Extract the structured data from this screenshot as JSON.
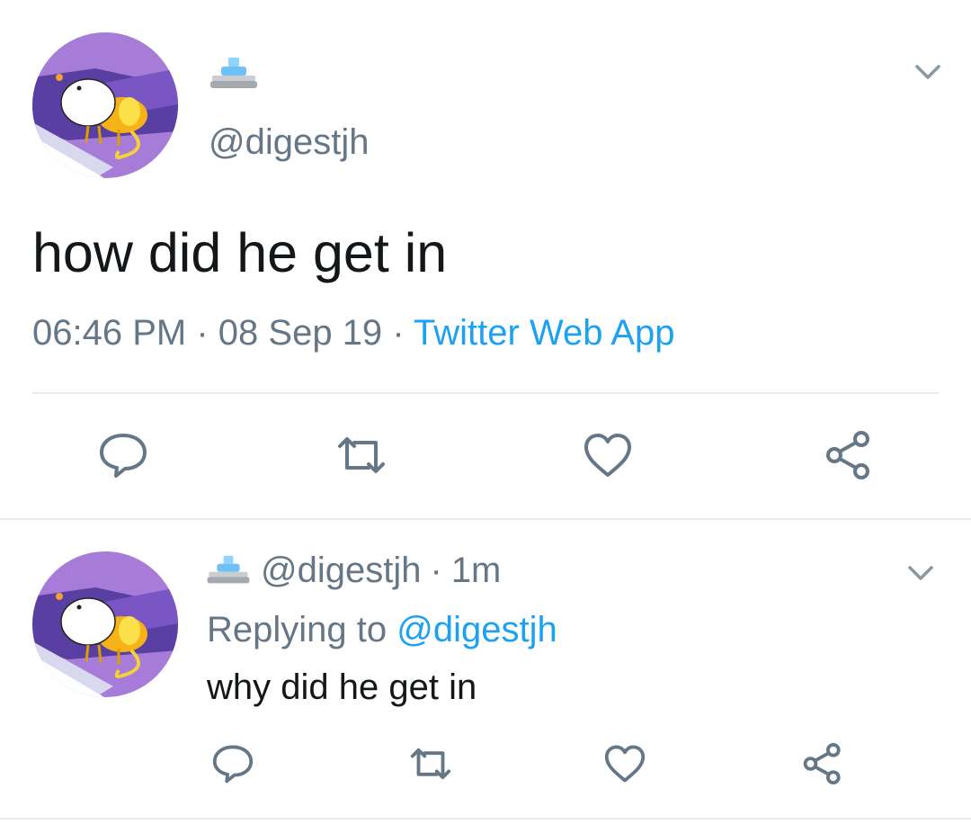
{
  "main_tweet": {
    "handle": "@digestjh",
    "display_name_icon": "fountain-emoji",
    "text": "how did he get in",
    "time": "06:46 PM",
    "separator": "·",
    "date": "08 Sep 19",
    "source": "Twitter Web App",
    "actions": [
      "reply-icon",
      "retweet-icon",
      "like-icon",
      "share-icon"
    ]
  },
  "reply_tweet": {
    "display_name_icon": "fountain-emoji",
    "handle": "@digestjh",
    "separator": "·",
    "age": "1m",
    "replying_prefix": "Replying to",
    "replying_to": "@digestjh",
    "text": "why did he get in",
    "actions": [
      "reply-icon",
      "retweet-icon",
      "like-icon",
      "share-icon"
    ]
  },
  "colors": {
    "text_primary": "#14171a",
    "text_secondary": "#657786",
    "link": "#1da1f2",
    "divider": "#e6ecf0"
  }
}
